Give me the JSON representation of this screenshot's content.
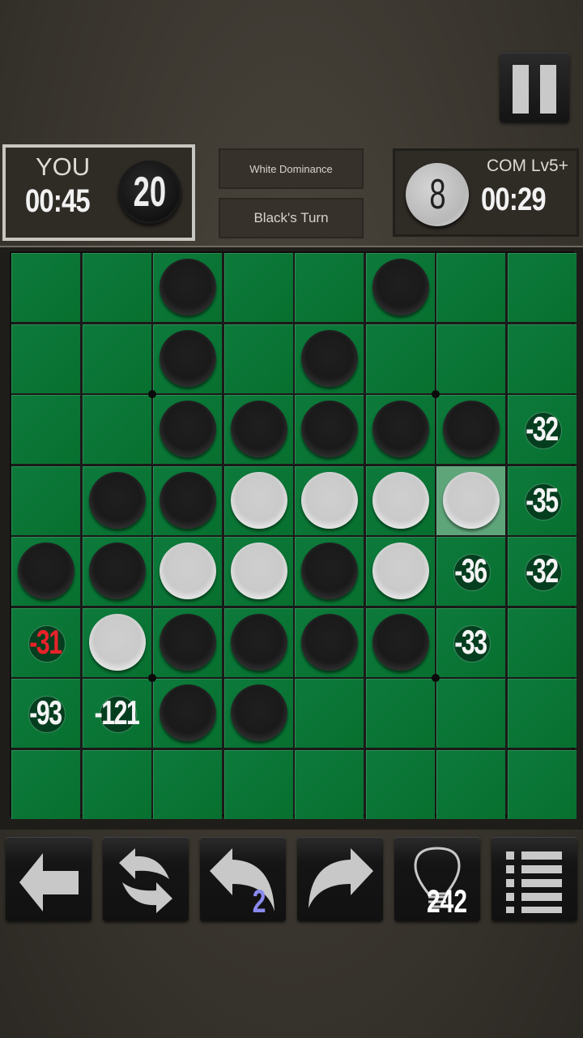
{
  "header": {
    "pause_icon": "pause-icon"
  },
  "players": {
    "you": {
      "name": "YOU",
      "timer": "00:45",
      "disc_count": "20",
      "disc_color": "black"
    },
    "com": {
      "name": "COM Lv5+",
      "timer": "00:29",
      "disc_count": "8",
      "disc_color": "white"
    }
  },
  "status": {
    "dominance": "White Dominance",
    "turn": "Black's Turn"
  },
  "board": {
    "size": 8,
    "rows": [
      [
        "",
        "",
        "B",
        "",
        "",
        "B",
        "",
        ""
      ],
      [
        "",
        "",
        "B",
        "",
        "B",
        "",
        "",
        ""
      ],
      [
        "",
        "",
        "B",
        "B",
        "B",
        "B",
        "B",
        ""
      ],
      [
        "",
        "B",
        "B",
        "W",
        "W",
        "W",
        "W",
        ""
      ],
      [
        "B",
        "B",
        "W",
        "W",
        "B",
        "W",
        "",
        ""
      ],
      [
        "",
        "W",
        "B",
        "B",
        "B",
        "B",
        "",
        ""
      ],
      [
        "",
        "",
        "B",
        "B",
        "",
        "",
        "",
        ""
      ],
      [
        "",
        "",
        "",
        "",
        "",
        "",
        "",
        ""
      ]
    ],
    "last_move": {
      "row": 3,
      "col": 6
    },
    "hints": [
      {
        "row": 2,
        "col": 7,
        "value": "-32",
        "best": false
      },
      {
        "row": 3,
        "col": 7,
        "value": "-35",
        "best": false
      },
      {
        "row": 4,
        "col": 6,
        "value": "-36",
        "best": false
      },
      {
        "row": 4,
        "col": 7,
        "value": "-32",
        "best": false
      },
      {
        "row": 5,
        "col": 0,
        "value": "-31",
        "best": true
      },
      {
        "row": 5,
        "col": 6,
        "value": "-33",
        "best": false
      },
      {
        "row": 6,
        "col": 0,
        "value": "-93",
        "best": false
      },
      {
        "row": 6,
        "col": 1,
        "value": "-121",
        "best": false
      }
    ],
    "colors": {
      "best_hint": "#e8222a",
      "normal_hint": "#f4f4f4",
      "felt": "#0a7536"
    }
  },
  "toolbar": {
    "buttons": [
      {
        "name": "back-button",
        "icon": "arrow-left-icon",
        "badge": ""
      },
      {
        "name": "swap-button",
        "icon": "swap-arrows-icon",
        "badge": ""
      },
      {
        "name": "undo-button",
        "icon": "undo-icon",
        "badge": "2",
        "badge_color": "#8a8af0"
      },
      {
        "name": "redo-button",
        "icon": "redo-icon",
        "badge": ""
      },
      {
        "name": "hint-button",
        "icon": "lightbulb-icon",
        "badge": "242",
        "badge_color": "#ffffff"
      },
      {
        "name": "menu-button",
        "icon": "list-icon",
        "badge": ""
      }
    ]
  }
}
